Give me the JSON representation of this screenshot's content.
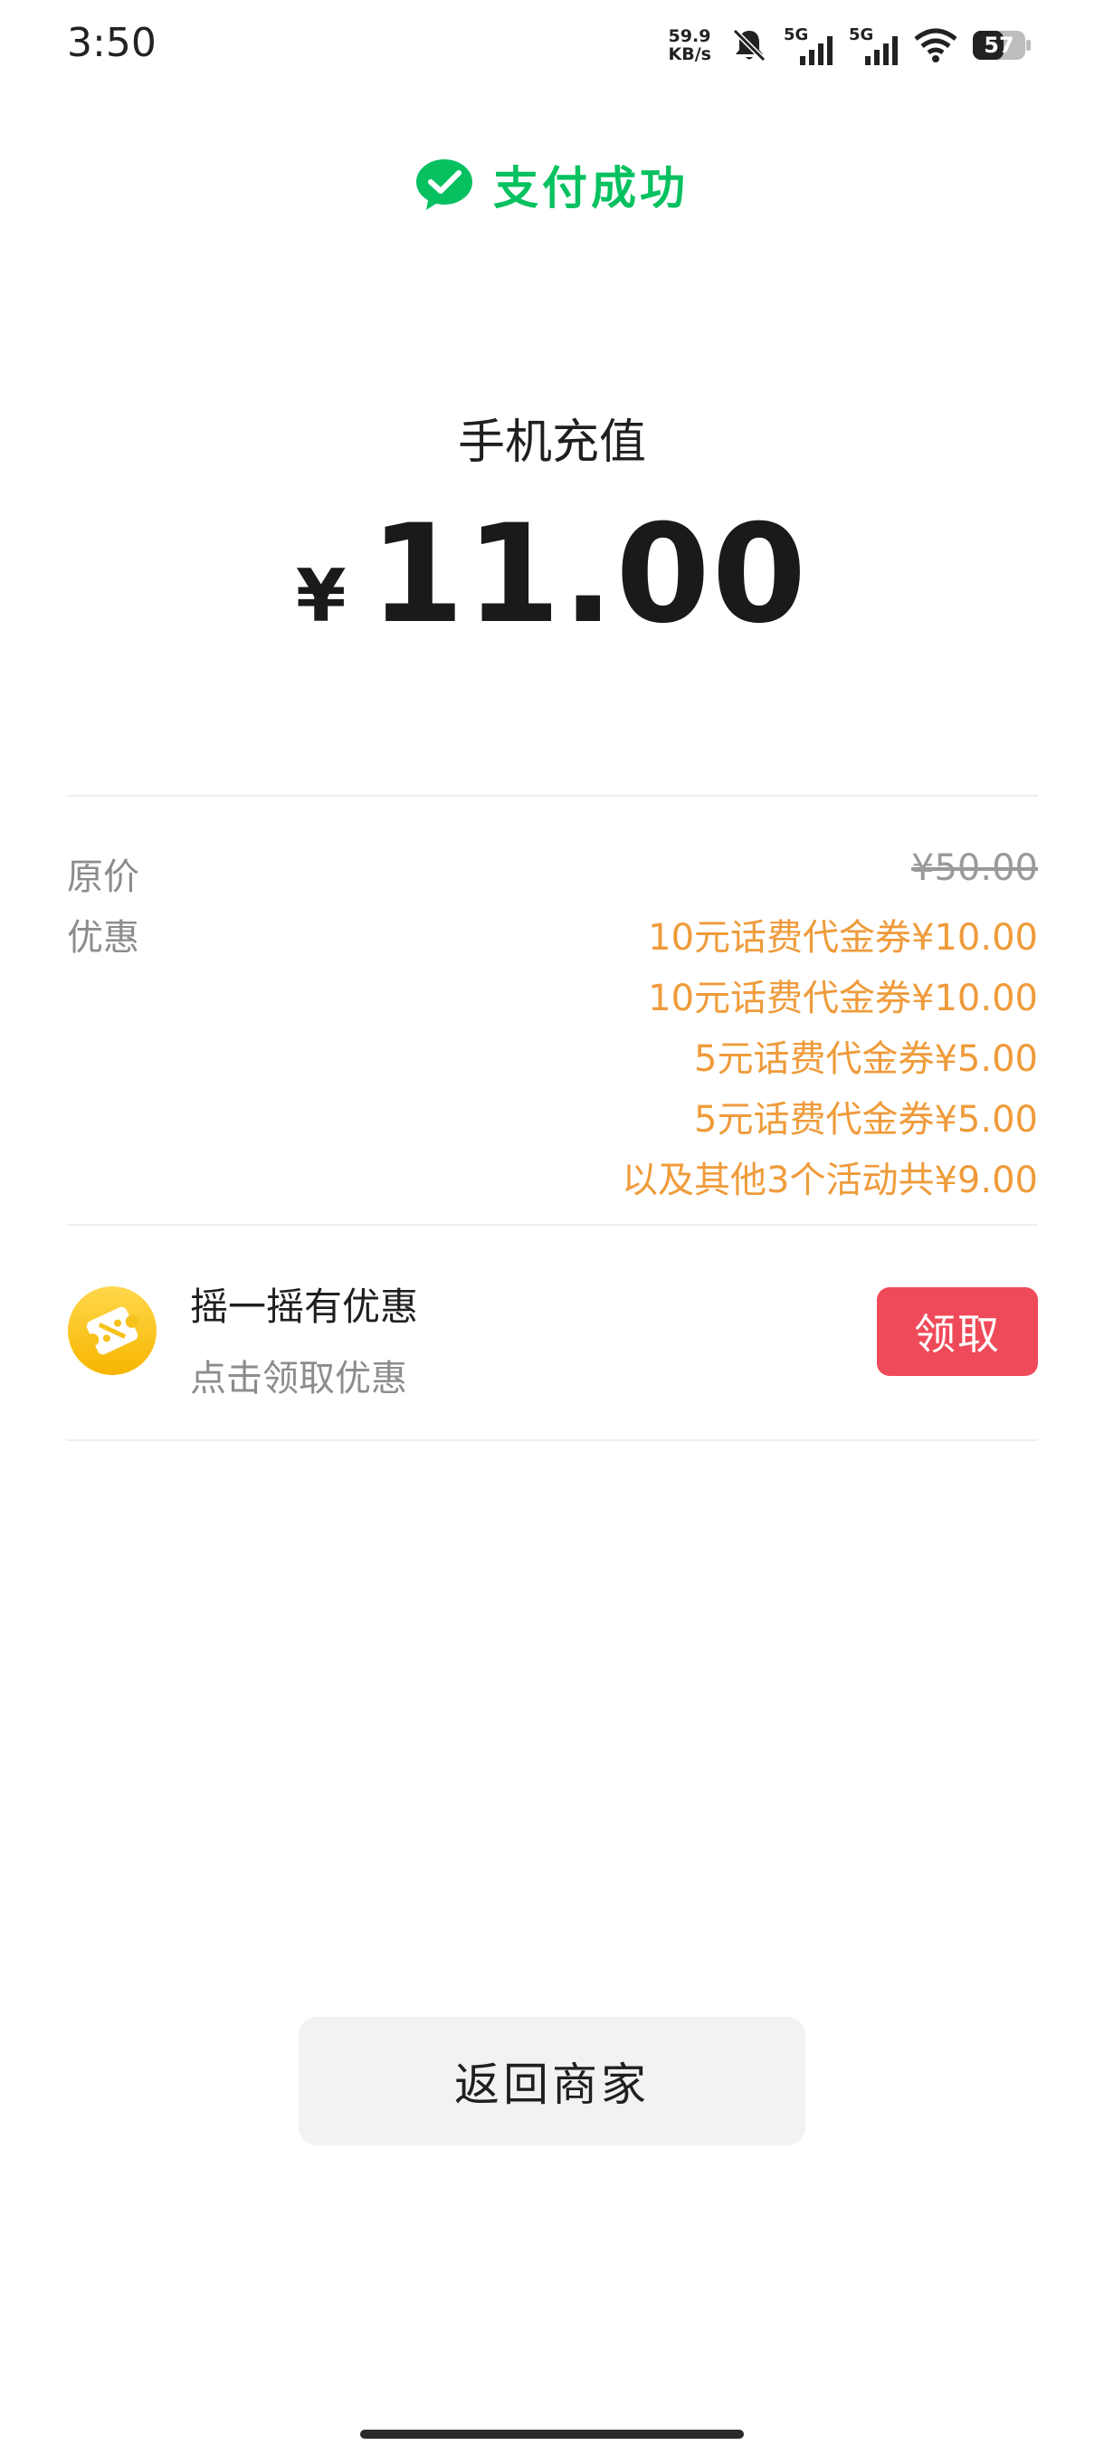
{
  "status_bar": {
    "time": "3:50",
    "net_speed_value": "59.9",
    "net_speed_unit": "KB/s",
    "sim1_tag": "5G",
    "sim2_tag": "5G",
    "battery_level": "57",
    "icons": [
      "bell-muted-icon",
      "signal-icon",
      "signal-icon",
      "wifi-icon",
      "battery-icon"
    ]
  },
  "header": {
    "title": "支付成功",
    "icon": "wechat-pay-icon",
    "accent_color": "#07c160"
  },
  "payment": {
    "merchant": "手机充值",
    "currency": "¥",
    "amount": "11.00"
  },
  "details": {
    "original_label": "原价",
    "original_value": "¥50.00",
    "discount_label": "优惠",
    "discount_color": "#ef9b3b",
    "discounts": [
      "10元话费代金券¥10.00",
      "10元话费代金券¥10.00",
      "5元话费代金券¥5.00",
      "5元话费代金券¥5.00",
      "以及其他3个活动共¥9.00"
    ]
  },
  "promo": {
    "title": "摇一摇有优惠",
    "subtitle": "点击领取优惠",
    "button_label": "领取",
    "icon": "coupon-icon",
    "button_color": "#ef4a59"
  },
  "footer": {
    "back_label": "返回商家"
  }
}
